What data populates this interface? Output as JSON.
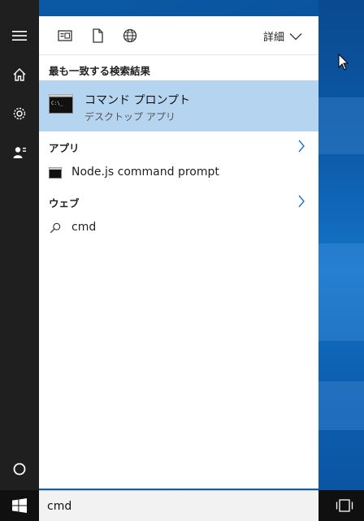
{
  "filter_bar": {
    "details_label": "詳細"
  },
  "results": {
    "best_match_title": "最も一致する検索結果",
    "best_match": {
      "title": "コマンド プロンプト",
      "subtitle": "デスクトップ アプリ"
    },
    "apps_header": "アプリ",
    "apps": [
      {
        "label": "Node.js command prompt"
      }
    ],
    "web_header": "ウェブ",
    "web": [
      {
        "label": "cmd"
      }
    ]
  },
  "search": {
    "value": "cmd"
  },
  "colors": {
    "selection": "#b5d4f0",
    "rail": "#1f1f1f",
    "taskbar": "#101010",
    "desktop": "#0b5aa6"
  },
  "icons": {
    "rail": [
      "hamburger-icon",
      "home-icon",
      "gear-icon",
      "user-icon",
      "cortana-icon"
    ],
    "filters": [
      "apps-filter-icon",
      "documents-filter-icon",
      "web-filter-icon"
    ],
    "taskbar": [
      "windows-logo-icon",
      "task-view-icon"
    ]
  }
}
